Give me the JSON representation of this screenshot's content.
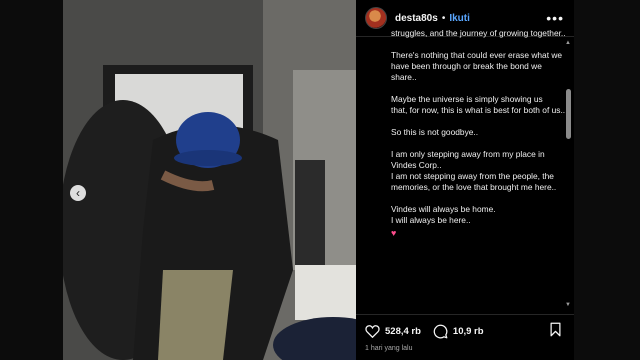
{
  "post": {
    "username": "desta80s",
    "separator": "•",
    "follow_label": "Ikuti",
    "more_icon": "more-horizontal-icon"
  },
  "caption": {
    "partial_top": "struggles, and the journey of growing together..",
    "paragraphs": [
      "There's nothing that could ever erase what we have been through or break the bond we share..",
      "Maybe the universe is simply showing us\nthat, for now, this is what is best for both of us..",
      "So this is not goodbye..",
      "I am only stepping away from my place in Vindes Corp..\nI am not stepping away from the people, the memories, or the love that brought me here..",
      "Vindes will always be home.\nI will always be here.."
    ],
    "emoji": "♥"
  },
  "actions": {
    "likes": "528,4 rb",
    "comments": "10,9 rb"
  },
  "timestamp": "1 hari yang lalu",
  "colors": {
    "background": "#000000",
    "follow": "#5aa7ff",
    "text": "#f5f5f5",
    "muted": "#a8a8a8"
  }
}
